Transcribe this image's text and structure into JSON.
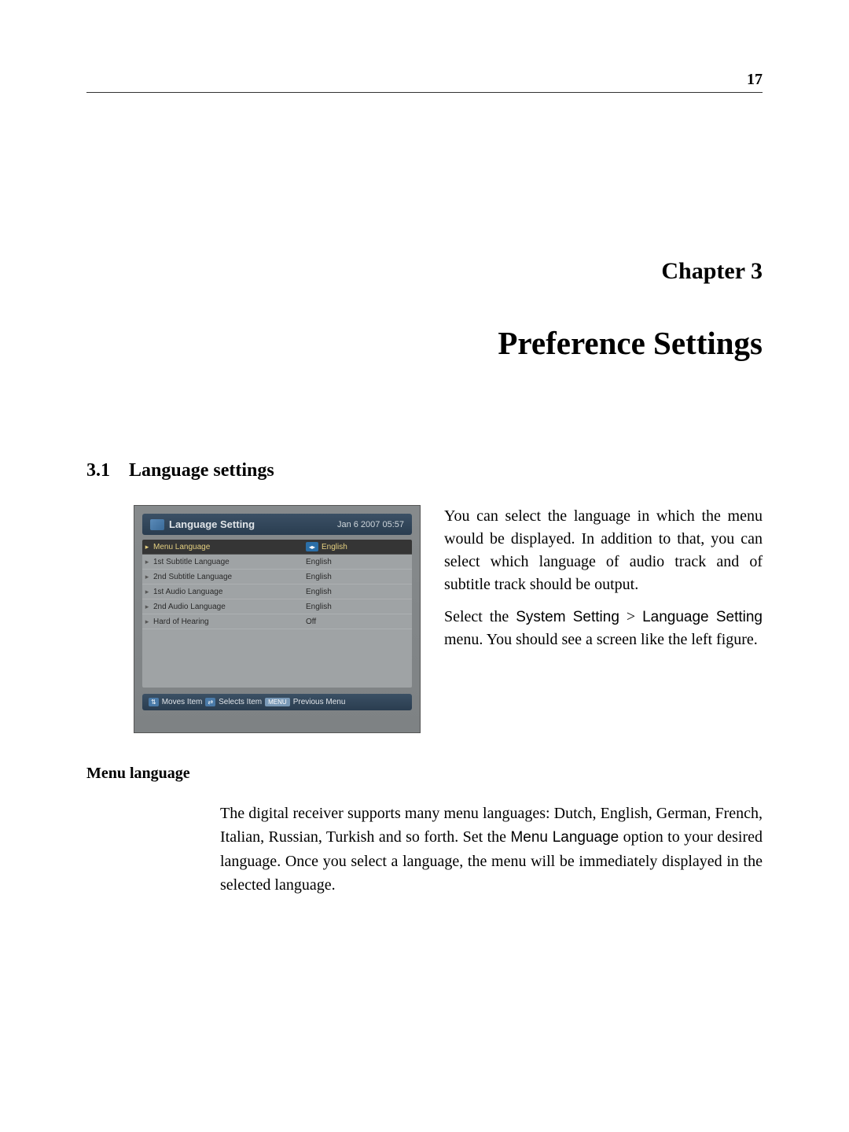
{
  "page_number": "17",
  "chapter_label": "Chapter 3",
  "chapter_title": "Preference Settings",
  "section": {
    "number": "3.1",
    "title": "Language settings"
  },
  "figure": {
    "title": "Language Setting",
    "timestamp": "Jan 6 2007 05:57",
    "rows": [
      {
        "label": "Menu Language",
        "value": "English",
        "selected": true,
        "has_lr": true
      },
      {
        "label": "1st Subtitle Language",
        "value": "English",
        "selected": false
      },
      {
        "label": "2nd Subtitle Language",
        "value": "English",
        "selected": false
      },
      {
        "label": "1st Audio Language",
        "value": "English",
        "selected": false
      },
      {
        "label": "2nd Audio Language",
        "value": "English",
        "selected": false
      },
      {
        "label": "Hard of Hearing",
        "value": "Off",
        "selected": false
      }
    ],
    "footer": {
      "moves": "Moves Item",
      "selects": "Selects Item",
      "menu_badge": "MENU",
      "previous": "Previous Menu"
    }
  },
  "intro_para_1": "You can select the language in which the menu would be displayed. In addition to that, you can select which language of audio track and of subtitle track should be output.",
  "intro_para_2a": "Select the ",
  "intro_para_2b": "System Setting",
  "intro_para_2c": " > ",
  "intro_para_2d": "Language Setting",
  "intro_para_2e": " menu. You should see a screen like the left figure.",
  "subsection_heading": "Menu language",
  "body_1a": "The digital receiver supports many menu languages: Dutch, English, German, French, Italian, Russian, Turkish and so forth. Set the ",
  "body_1b": "Menu Language",
  "body_1c": " option to your desired language. Once you select a language, the menu will be immediately displayed in the selected language."
}
